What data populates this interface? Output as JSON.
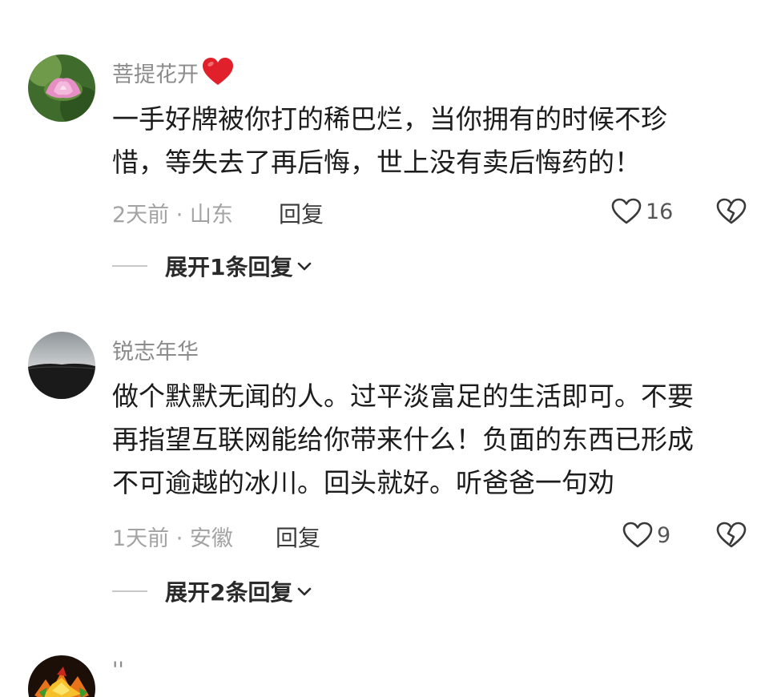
{
  "comments": [
    {
      "username": "菩提花开",
      "text_lines": [
        "一手好牌被你打的稀巴烂，当你拥有的时候不珍",
        "惜，等失去了再后悔，世上没有卖后悔药的！"
      ],
      "meta": "2天前 · 山东",
      "reply_label": "回复",
      "like_count": "16",
      "expand_label": "展开1条回复"
    },
    {
      "username": "锐志年华",
      "text_lines": [
        "做个默默无闻的人。过平淡富足的生活即可。不要",
        "再指望互联网能给你带来什么！负面的东西已形成",
        "不可逾越的冰川。回头就好。听爸爸一句劝"
      ],
      "meta": "1天前 · 安徽",
      "reply_label": "回复",
      "like_count": "9",
      "expand_label": "展开2条回复"
    },
    {
      "username": "''"
    }
  ],
  "icons": {
    "like": "heart-outline-icon",
    "dislike": "broken-heart-icon",
    "badge": "red-heart-icon",
    "expand": "chevron-down-icon"
  },
  "colors": {
    "badge_red": "#e0202a",
    "username_gray": "#8c8c8c",
    "meta_gray": "#a3a3a3"
  }
}
